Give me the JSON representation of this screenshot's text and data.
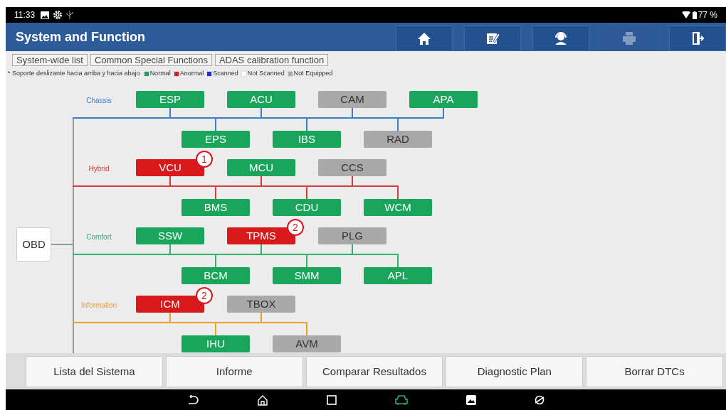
{
  "status_bar": {
    "time": "11:33",
    "battery": "77 %"
  },
  "header": {
    "title": "System and Function",
    "buttons": [
      {
        "kind": "home",
        "disabled": false
      },
      {
        "kind": "edit",
        "disabled": false
      },
      {
        "kind": "support",
        "disabled": false
      },
      {
        "kind": "print",
        "disabled": true
      },
      {
        "kind": "exit",
        "disabled": false
      }
    ]
  },
  "tabs": [
    {
      "label": "System-wide list"
    },
    {
      "label": "Common Special Functions"
    },
    {
      "label": "ADAS calibration function"
    }
  ],
  "legend": {
    "note": "* Soporte deslizante hacia arriba y hacia abajo",
    "items": [
      {
        "label": "Normal",
        "color": "#1aa65a"
      },
      {
        "label": "Anormal",
        "color": "#d7191c"
      },
      {
        "label": "Scanned",
        "color": "#1f2fe0"
      },
      {
        "label": "Not Scanned",
        "color": "#ffffff"
      },
      {
        "label": "Not Equipped",
        "color": "#a9a9a9"
      }
    ]
  },
  "diagram": {
    "root": "OBD",
    "groups": [
      {
        "name": "Chassis",
        "color": "#3a7fc8",
        "top": [
          {
            "name": "ESP",
            "kind": "normal"
          },
          {
            "name": "ACU",
            "kind": "normal"
          },
          {
            "name": "CAM",
            "kind": "unequipped"
          },
          {
            "name": "APA",
            "kind": "normal"
          }
        ],
        "bottom": [
          {
            "name": "EPS",
            "kind": "normal"
          },
          {
            "name": "IBS",
            "kind": "normal"
          },
          {
            "name": "RAD",
            "kind": "unequipped"
          }
        ]
      },
      {
        "name": "Hybrid",
        "color": "#d63a3a",
        "top": [
          {
            "name": "VCU",
            "kind": "abnormal",
            "badge": "1"
          },
          {
            "name": "MCU",
            "kind": "normal"
          },
          {
            "name": "CCS",
            "kind": "unequipped"
          }
        ],
        "bottom": [
          {
            "name": "BMS",
            "kind": "normal"
          },
          {
            "name": "CDU",
            "kind": "normal"
          },
          {
            "name": "WCM",
            "kind": "normal"
          }
        ]
      },
      {
        "name": "Comfort",
        "color": "#2db36b",
        "top": [
          {
            "name": "SSW",
            "kind": "normal"
          },
          {
            "name": "TPMS",
            "kind": "abnormal",
            "badge": "2"
          },
          {
            "name": "PLG",
            "kind": "unequipped"
          }
        ],
        "bottom": [
          {
            "name": "BCM",
            "kind": "normal"
          },
          {
            "name": "SMM",
            "kind": "normal"
          },
          {
            "name": "APL",
            "kind": "normal"
          }
        ]
      },
      {
        "name": "Information",
        "color": "#f0a020",
        "top": [
          {
            "name": "ICM",
            "kind": "abnormal",
            "badge": "2"
          },
          {
            "name": "TBOX",
            "kind": "unequipped"
          }
        ],
        "bottom": [
          {
            "name": "IHU",
            "kind": "normal"
          },
          {
            "name": "AVM",
            "kind": "unequipped"
          }
        ]
      }
    ]
  },
  "bottom_buttons": [
    "Lista del Sistema",
    "Informe",
    "Comparar Resultados",
    "Diagnostic Plan",
    "Borrar DTCs"
  ]
}
